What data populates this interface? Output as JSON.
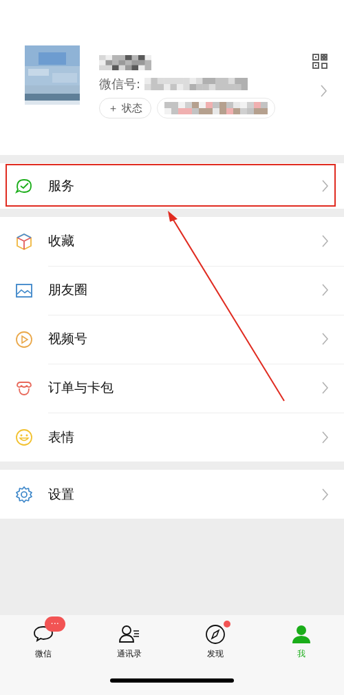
{
  "profile": {
    "id_label": "微信号:",
    "status_button": "＋ 状态"
  },
  "service_row": {
    "label": "服务",
    "highlighted": true
  },
  "menu_groups": [
    [
      {
        "label": "收藏"
      },
      {
        "label": "朋友圈"
      },
      {
        "label": "视频号"
      },
      {
        "label": "订单与卡包"
      },
      {
        "label": "表情"
      }
    ],
    [
      {
        "label": "设置"
      }
    ]
  ],
  "tabs": [
    {
      "label": "微信",
      "selected": false,
      "badge": "···",
      "dot": false
    },
    {
      "label": "通讯录",
      "selected": false,
      "dot": false
    },
    {
      "label": "发现",
      "selected": false,
      "dot": true
    },
    {
      "label": "我",
      "selected": true,
      "dot": false
    }
  ]
}
